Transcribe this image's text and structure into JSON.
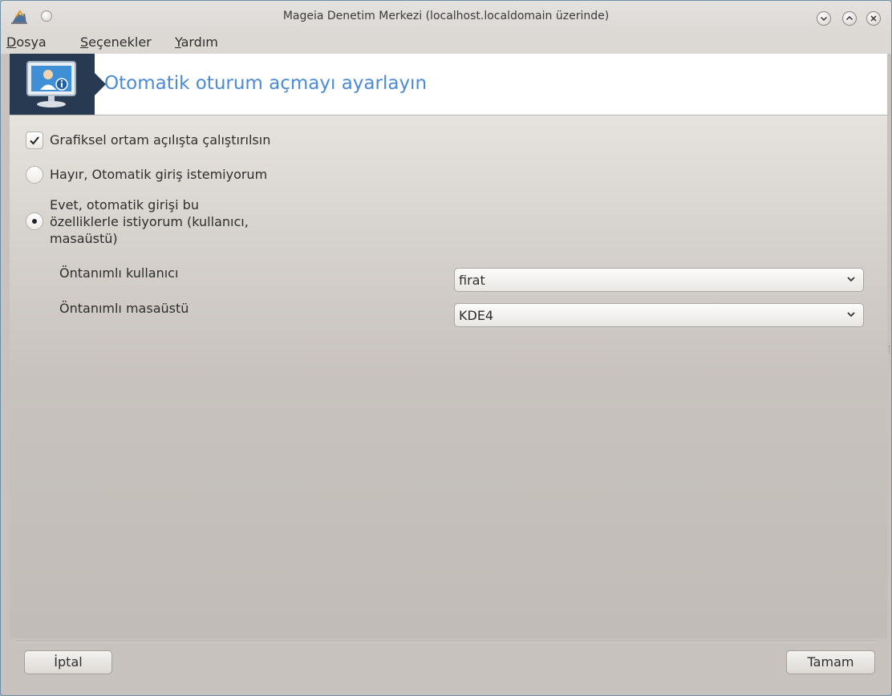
{
  "window": {
    "title": "Mageia Denetim Merkezi  (localhost.localdomain üzerinde)",
    "icons": [
      "app-icon",
      "shade-icon",
      "minimize-icon",
      "maximize-icon",
      "close-icon"
    ]
  },
  "menubar": {
    "items": [
      {
        "mnemonic": "D",
        "rest": "osya"
      },
      {
        "mnemonic": "S",
        "rest": "eçenekler"
      },
      {
        "mnemonic": "Y",
        "rest": "ardım"
      }
    ]
  },
  "banner": {
    "title": "Otomatik oturum açmayı ayarlayın",
    "icon": "monitor-user-info-icon"
  },
  "options": {
    "start_graphical": {
      "label": "Grafiksel ortam açılışta çalıştırılsın",
      "checked": true
    },
    "autologin_no": {
      "label": "Hayır, Otomatik giriş istemiyorum",
      "selected": false
    },
    "autologin_yes": {
      "label": "Evet, otomatik girişi bu\nözelliklerle istiyorum (kullanıcı,\nmasaüstü)",
      "selected": true
    }
  },
  "fields": {
    "default_user": {
      "label": "Öntanımlı kullanıcı",
      "value": "firat"
    },
    "default_desktop": {
      "label": "Öntanımlı masaüstü",
      "value": "KDE4"
    }
  },
  "buttons": {
    "cancel": "İptal",
    "ok": "Tamam"
  }
}
